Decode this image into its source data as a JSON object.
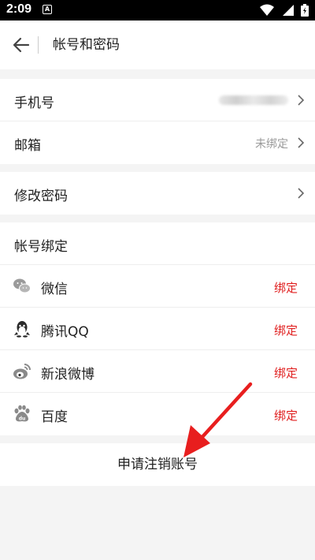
{
  "status_bar": {
    "time": "2:09",
    "notification_badge": "A"
  },
  "header": {
    "title": "帐号和密码"
  },
  "phone": {
    "label": "手机号"
  },
  "email": {
    "label": "邮箱",
    "value": "未绑定"
  },
  "password": {
    "label": "修改密码"
  },
  "binding_section": {
    "title": "帐号绑定"
  },
  "bindings": [
    {
      "name": "微信",
      "icon": "wechat-icon",
      "action": "绑定"
    },
    {
      "name": "腾讯QQ",
      "icon": "qq-icon",
      "action": "绑定"
    },
    {
      "name": "新浪微博",
      "icon": "weibo-icon",
      "action": "绑定"
    },
    {
      "name": "百度",
      "icon": "baidu-icon",
      "action": "绑定"
    }
  ],
  "deactivate": {
    "label": "申请注销账号"
  },
  "colors": {
    "bind_action": "#e02020",
    "annotation_arrow": "#e81e1e",
    "background": "#f4f4f4"
  }
}
